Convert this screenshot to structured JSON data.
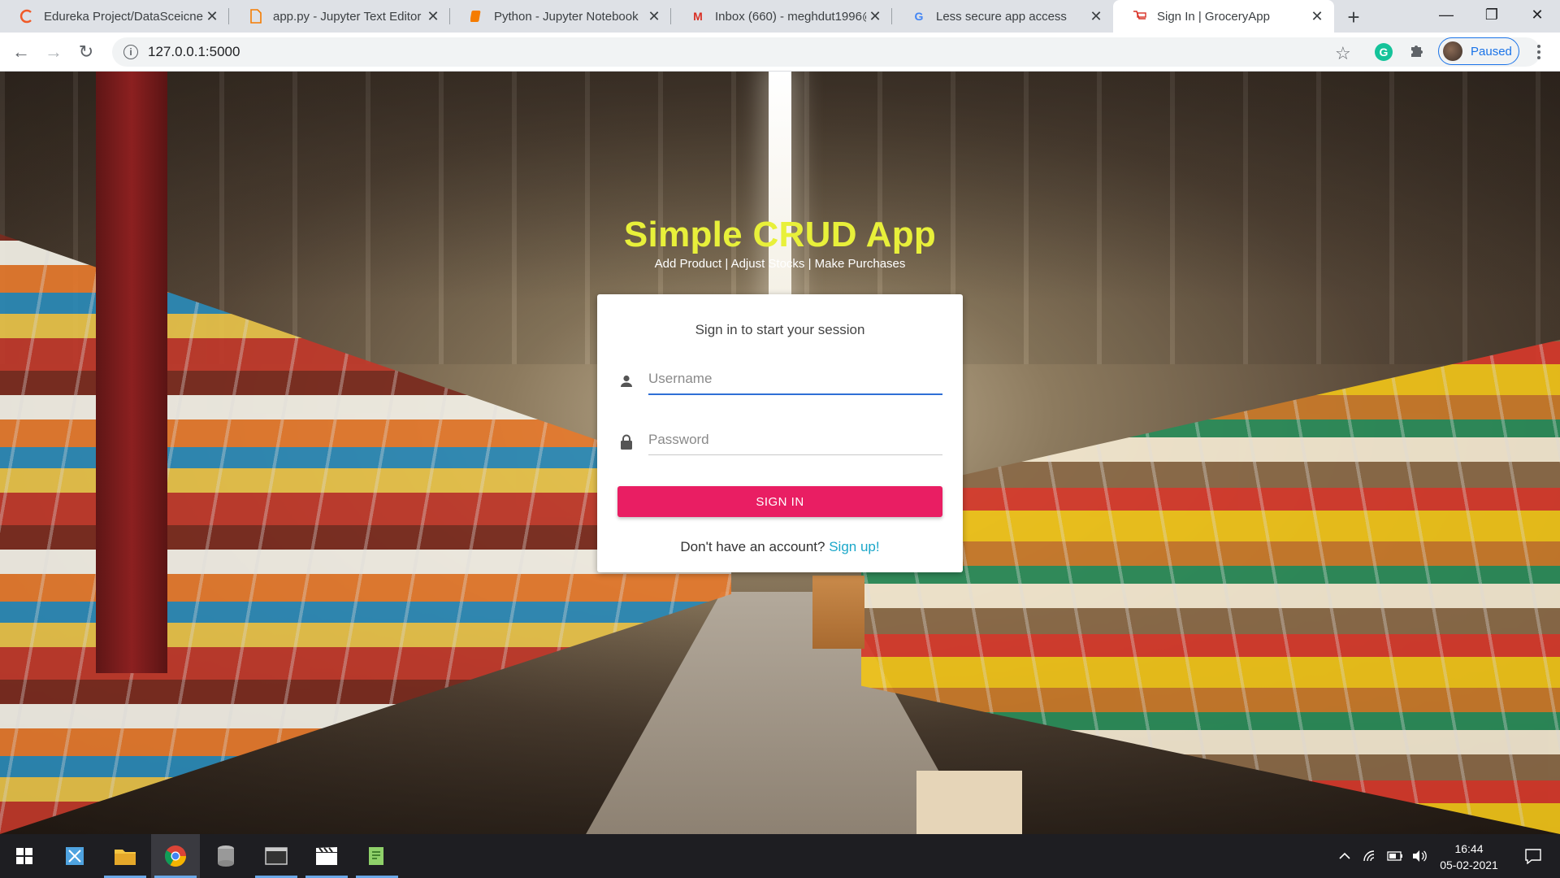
{
  "browser": {
    "tabs": [
      {
        "title": "Edureka Project/DataSceicne",
        "favicon": "edureka-icon"
      },
      {
        "title": "app.py - Jupyter Text Editor",
        "favicon": "file-icon"
      },
      {
        "title": "Python - Jupyter Notebook",
        "favicon": "jupyter-icon"
      },
      {
        "title": "Inbox (660) - meghdut1996@",
        "favicon": "gmail-icon"
      },
      {
        "title": "Less secure app access",
        "favicon": "google-icon"
      },
      {
        "title": "Sign In | GroceryApp",
        "favicon": "groceryapp-icon",
        "active": true
      }
    ],
    "url": "127.0.0.1:5000",
    "profile_label": "Paused",
    "accent_color": "#1a73e8"
  },
  "app": {
    "title": "Simple CRUD App",
    "tagline": "Add Product | Adjust Stocks | Make Purchases",
    "title_color": "#e8f03a"
  },
  "login": {
    "subtitle": "Sign in to start your session",
    "username_placeholder": "Username",
    "password_placeholder": "Password",
    "submit_label": "SIGN IN",
    "submit_color": "#e91e63",
    "signup_prompt": "Don't have an account?",
    "signup_link": "Sign up!",
    "link_color": "#1aa7c9"
  },
  "taskbar": {
    "apps": [
      "windows-start-icon",
      "snip-icon",
      "file-explorer-icon",
      "chrome-icon",
      "database-icon",
      "terminal-icon",
      "video-editor-icon",
      "notepad-icon"
    ],
    "time": "16:44",
    "date": "05-02-2021"
  }
}
